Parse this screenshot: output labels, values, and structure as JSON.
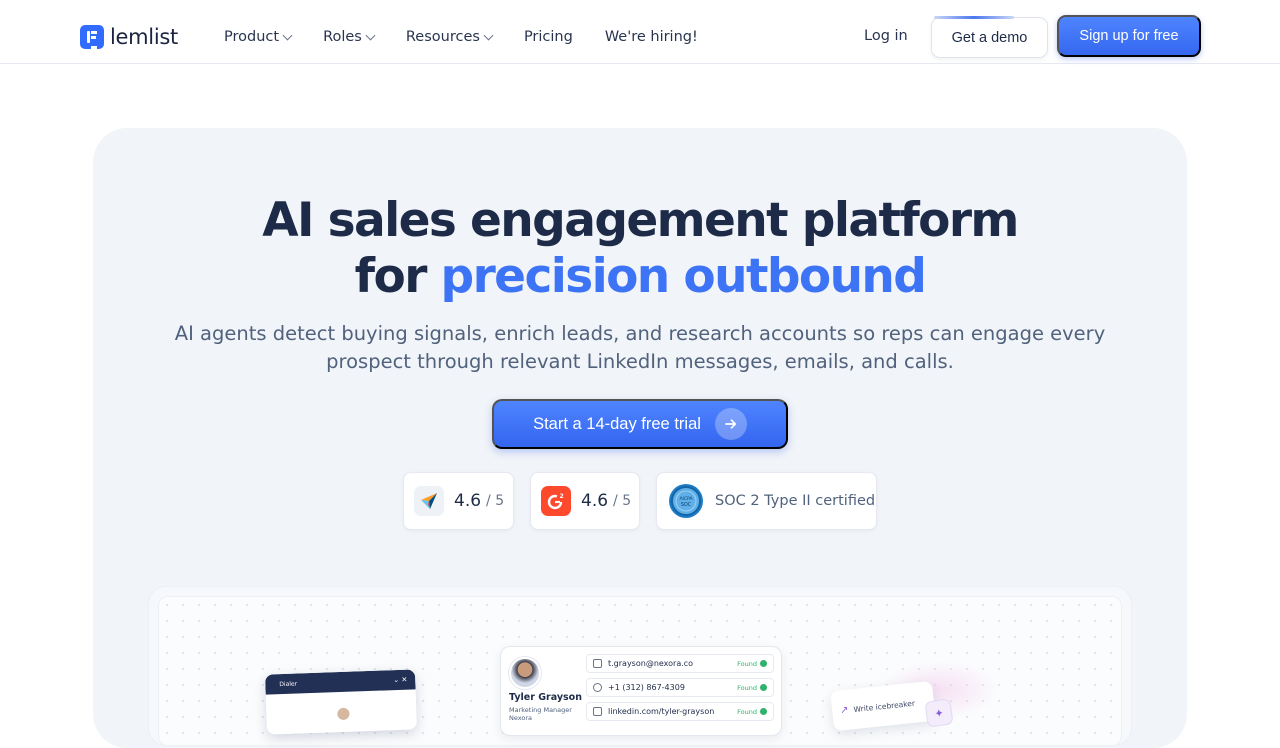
{
  "brand": {
    "name": "lemlist"
  },
  "nav": {
    "items": [
      {
        "label": "Product",
        "dropdown": true
      },
      {
        "label": "Roles",
        "dropdown": true
      },
      {
        "label": "Resources",
        "dropdown": true
      },
      {
        "label": "Pricing",
        "dropdown": false
      },
      {
        "label": "We're hiring!",
        "dropdown": false
      }
    ],
    "login": "Log in",
    "demo": "Get a demo",
    "signup": "Sign up for free"
  },
  "hero": {
    "title_line1": "AI sales engagement platform",
    "title_line2_prefix": "for",
    "title_line2_accent": "precision outbound",
    "subtitle": "AI agents detect buying signals, enrich leads, and research accounts so reps can engage every prospect through relevant LinkedIn messages, emails, and calls.",
    "cta": "Start a 14-day free trial"
  },
  "badges": [
    {
      "icon": "capterra-icon",
      "score": "4.6",
      "outof": "/ 5"
    },
    {
      "icon": "g2-icon",
      "score": "4.6",
      "outof": "/ 5"
    },
    {
      "icon": "aicpa-soc-icon",
      "text": "SOC 2 Type II certified",
      "seal_text": "AICPA SOC"
    }
  ],
  "preview": {
    "dialer": {
      "title": "Dialer"
    },
    "contact": {
      "name": "Tyler Grayson",
      "role": "Marketing Manager",
      "company": "Nexora",
      "rows": [
        {
          "icon": "mail-icon",
          "value": "t.grayson@nexora.co",
          "status": "Found"
        },
        {
          "icon": "phone-icon",
          "value": "+1 (312) 867-4309",
          "status": "Found"
        },
        {
          "icon": "linkedin-icon",
          "value": "linkedin.com/tyler-grayson",
          "status": "Found"
        }
      ]
    },
    "icebreaker": {
      "label": "Write icebreaker"
    }
  },
  "colors": {
    "accent": "#3d73f5",
    "brand": "#316bff",
    "hero_bg": "#f1f4f8",
    "found": "#2fb36b"
  }
}
